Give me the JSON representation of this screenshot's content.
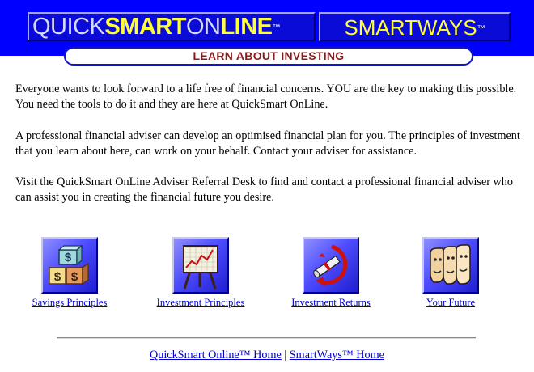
{
  "header": {
    "logo_quicksmart": {
      "quick": "QUICK",
      "smart": "SMART",
      "on": "ON",
      "line": "LINE",
      "tm": "™"
    },
    "logo_smartways": {
      "text": "SMARTWAYS",
      "tm": "™"
    },
    "colors": {
      "background": "#0000ff",
      "logo_accent": "#ffff33"
    }
  },
  "banner": {
    "title": "LEARN ABOUT INVESTING",
    "color": "#8b1a1a"
  },
  "content": {
    "paragraphs": [
      "Everyone wants to look forward to a life free of financial concerns. YOU are the key to making this possible. You need the tools to do it and they are here at QuickSmart OnLine.",
      "A professional financial adviser can develop an optimised financial plan for you. The principles of investment that you learn about here, can work on your behalf. Contact your adviser for assistance.",
      "Visit the QuickSmart OnLine Adviser Referral Desk to find and contact a professional financial adviser who can assist you in creating the financial future you desire."
    ]
  },
  "nav": [
    {
      "label": "Savings Principles",
      "icon": "money-bags-blocks-icon"
    },
    {
      "label": "Investment Principles",
      "icon": "chart-easel-icon"
    },
    {
      "label": "Investment Returns",
      "icon": "returning-diploma-icon"
    },
    {
      "label": "Your Future",
      "icon": "faces-icon"
    }
  ],
  "footer": {
    "home_link": "QuickSmart Online™ Home",
    "separator": "|",
    "smartways_link": "SmartWays™ Home"
  }
}
